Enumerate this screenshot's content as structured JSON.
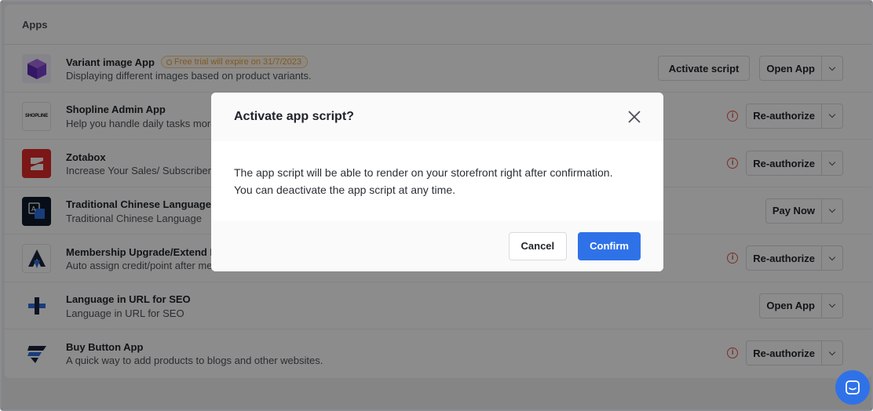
{
  "panel": {
    "title": "Apps"
  },
  "apps": [
    {
      "name": "Variant image App",
      "badge": "Free trial will expire on 31/7/2023",
      "desc": "Displaying different images based on product variants.",
      "icon": "cube-icon",
      "actions": {
        "secondary": "Activate script",
        "primary": "Open App",
        "warning": false
      }
    },
    {
      "name": "Shopline Admin App",
      "desc": "Help you handle daily tasks more",
      "icon": "shopline-logo-icon",
      "icon_text": "SHOPLINE",
      "actions": {
        "primary": "Re-authorize",
        "warning": true
      }
    },
    {
      "name": "Zotabox",
      "desc": "Increase Your Sales/ Subscribers",
      "icon": "zotabox-logo-icon",
      "actions": {
        "primary": "Re-authorize",
        "warning": true
      }
    },
    {
      "name": "Traditional Chinese Language",
      "desc": "Traditional Chinese Language",
      "icon": "translate-icon",
      "actions": {
        "primary": "Pay Now",
        "warning": false
      }
    },
    {
      "name": "Membership Upgrade/Extend R",
      "desc": "Auto assign credit/point after me",
      "icon": "membership-logo-icon",
      "actions": {
        "primary": "Re-authorize",
        "warning": true
      }
    },
    {
      "name": "Language in URL for SEO",
      "desc": "Language in URL for SEO",
      "icon": "language-url-logo-icon",
      "actions": {
        "primary": "Open App",
        "warning": false
      }
    },
    {
      "name": "Buy Button App",
      "desc": "A quick way to add products to blogs and other websites.",
      "icon": "buy-button-logo-icon",
      "actions": {
        "primary": "Re-authorize",
        "warning": true
      }
    }
  ],
  "modal": {
    "title": "Activate app script?",
    "body_line1": "The app script will be able to render on your storefront right after confirmation.",
    "body_line2": "You can deactivate the app script at any time.",
    "cancel_label": "Cancel",
    "confirm_label": "Confirm"
  },
  "colors": {
    "accent": "#2f72e8",
    "warning": "#e0554a",
    "trial": "#e7a33e"
  }
}
